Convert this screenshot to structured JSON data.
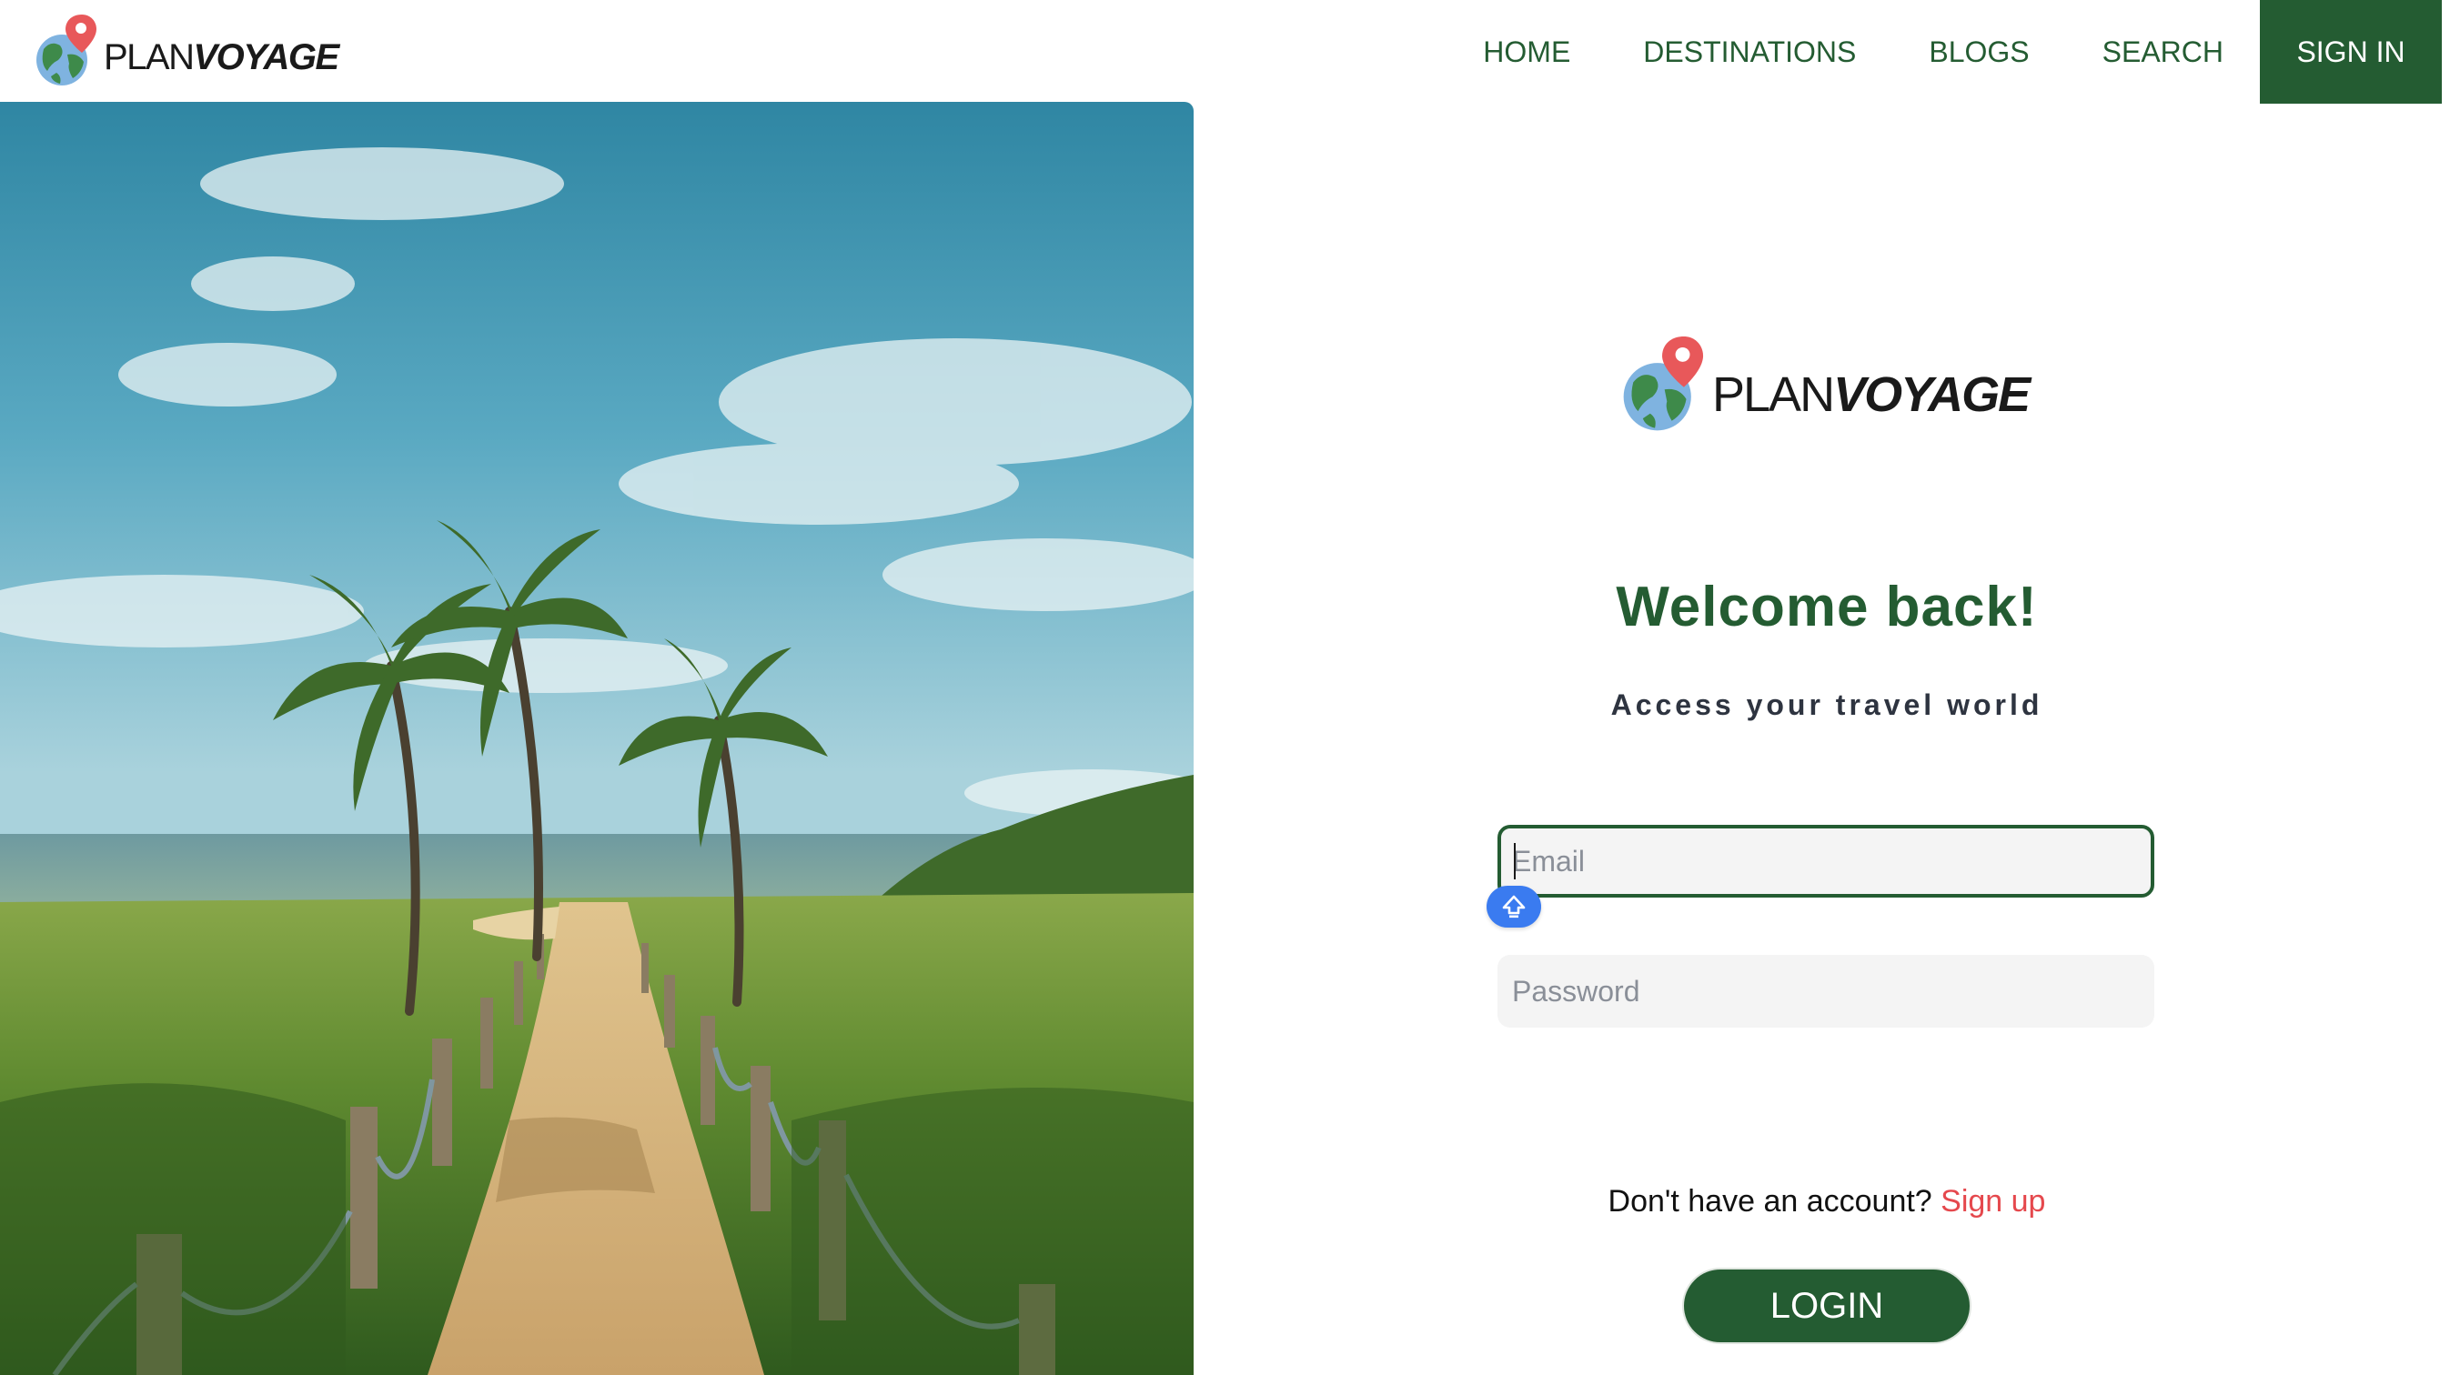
{
  "brand": {
    "plan": "PLAN",
    "voyage": "VOYAGE",
    "logo_icon": "globe-map-pin-icon"
  },
  "nav": {
    "items": [
      "HOME",
      "DESTINATIONS",
      "BLOGS",
      "SEARCH"
    ],
    "signin_label": "SIGN IN"
  },
  "hero": {
    "image": "beach-path-palm-trees-photo"
  },
  "login": {
    "title": "Welcome back!",
    "subtitle": "Access your travel world",
    "email_placeholder": "Email",
    "password_placeholder": "Password",
    "no_account_text": "Don't have an account?",
    "signup_link": "Sign up",
    "login_button": "LOGIN",
    "keyboard_badge_icon": "caps-lock-arrow-icon"
  },
  "colors": {
    "primary_green": "#245c32",
    "link_red": "#e5484d",
    "input_bg": "#f4f4f4",
    "badge_blue": "#3a7bf0"
  }
}
